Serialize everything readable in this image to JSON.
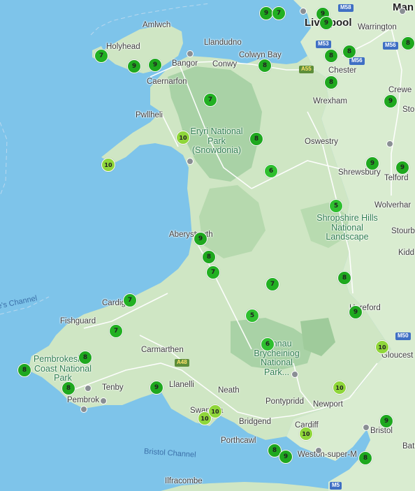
{
  "map": {
    "colors": {
      "sea": "#7ec4ea",
      "land": "#cfe6c4",
      "uplands": "#a9d2a6",
      "roads": "#ffffff",
      "markers": "#22b022",
      "marker_high": "#8fd63a",
      "poi": "#8a8f94"
    },
    "places": {
      "liverpool": "Liverpool",
      "warrington": "Warrington",
      "manchester": "Man",
      "chester": "Chester",
      "crewe": "Crewe",
      "stoke": "Sto",
      "wrexham": "Wrexham",
      "oswestry": "Oswestry",
      "shrewsbury": "Shrewsbury",
      "telford": "Telford",
      "wolverhampton": "Wolverhar",
      "stourbridge": "Stourb",
      "kidderminster": "Kidd",
      "hereford": "Hereford",
      "gloucester": "Gloucest",
      "bristol": "Bristol",
      "bath": "Bat",
      "newport": "Newport",
      "cardiff": "Cardiff",
      "pontypridd": "Pontypridd",
      "neath": "Neath",
      "swansea": "Swansea",
      "llanelli": "Llanelli",
      "bridgend": "Bridgend",
      "porthcawl": "Porthcawl",
      "weston": "Weston-super-M",
      "carmarthen": "Carmarthen",
      "tenby": "Tenby",
      "pembroke": "Pembrok",
      "fishguard": "Fishguard",
      "cardigan": "Cardig",
      "aberystwyth": "Aberystwyth",
      "pwllheli": "Pwllheli",
      "caernarfon": "Caernarfon",
      "bangor": "Bangor",
      "holyhead": "Holyhead",
      "amlwch": "Amlwch",
      "llandudno": "Llandudno",
      "conwy": "Conwy",
      "colwyn_bay": "Colwyn Bay",
      "ilfracombe": "Ilfracombe"
    },
    "parks": {
      "eryri": "Eryri National Park (Snowdonia)",
      "shropshire": "Shropshire Hills National Landscape",
      "brecon": "Bannau Brycheiniog National Park...",
      "pembrokeshire": "Pembrokeshire Coast National Park"
    },
    "water": {
      "st_georges": "e's Channel",
      "bristol_channel": "Bristol Channel"
    },
    "roads": {
      "m58": "M58",
      "m53": "M53",
      "m56": "M56",
      "m6": "M6",
      "m50": "M50",
      "m5": "M5",
      "a55": "A55",
      "a48": "A48"
    },
    "markers": [
      {
        "label": "9"
      },
      {
        "label": "7"
      },
      {
        "label": "9"
      },
      {
        "label": "9"
      },
      {
        "label": "8"
      },
      {
        "label": "8"
      },
      {
        "label": "8"
      },
      {
        "label": "8"
      },
      {
        "label": "7"
      },
      {
        "label": "9"
      },
      {
        "label": "9"
      },
      {
        "label": "8"
      },
      {
        "label": "9"
      },
      {
        "label": "7"
      },
      {
        "label": "10"
      },
      {
        "label": "8"
      },
      {
        "label": "10"
      },
      {
        "label": "6"
      },
      {
        "label": "9"
      },
      {
        "label": "9"
      },
      {
        "label": "5"
      },
      {
        "label": "9"
      },
      {
        "label": "8"
      },
      {
        "label": "7"
      },
      {
        "label": "7"
      },
      {
        "label": "8"
      },
      {
        "label": "7"
      },
      {
        "label": "5"
      },
      {
        "label": "9"
      },
      {
        "label": "7"
      },
      {
        "label": "6"
      },
      {
        "label": "10"
      },
      {
        "label": "8"
      },
      {
        "label": "8"
      },
      {
        "label": "8"
      },
      {
        "label": "9"
      },
      {
        "label": "10"
      },
      {
        "label": "10"
      },
      {
        "label": "10"
      },
      {
        "label": "9"
      },
      {
        "label": "10"
      },
      {
        "label": "8"
      },
      {
        "label": "9"
      },
      {
        "label": "8"
      }
    ]
  }
}
